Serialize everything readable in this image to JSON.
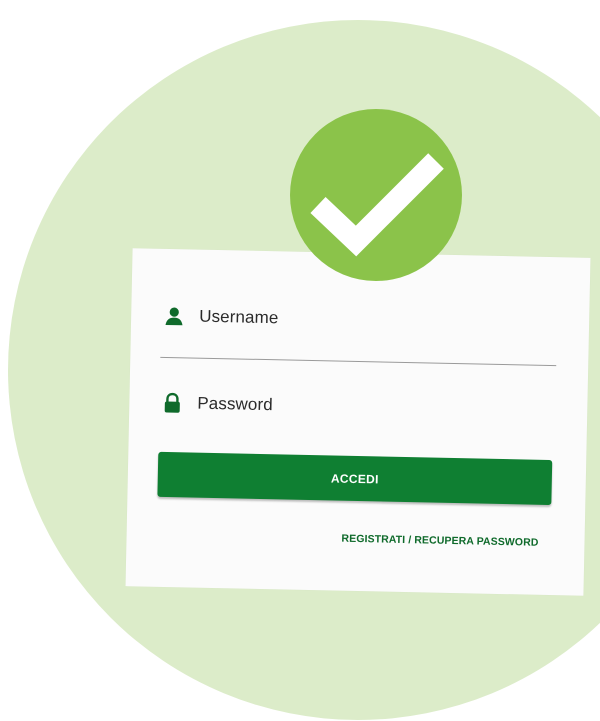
{
  "login_form": {
    "username_label": "Username",
    "password_label": "Password",
    "submit_label": "ACCEDI",
    "register_link": "REGISTRATI / RECUPERA PASSWORD"
  },
  "colors": {
    "background_circle": "#dcecc9",
    "check_badge": "#8bc34a",
    "primary_green": "#0f7f32"
  },
  "icons": {
    "username": "user-icon",
    "password": "lock-icon",
    "badge": "checkmark-icon"
  }
}
